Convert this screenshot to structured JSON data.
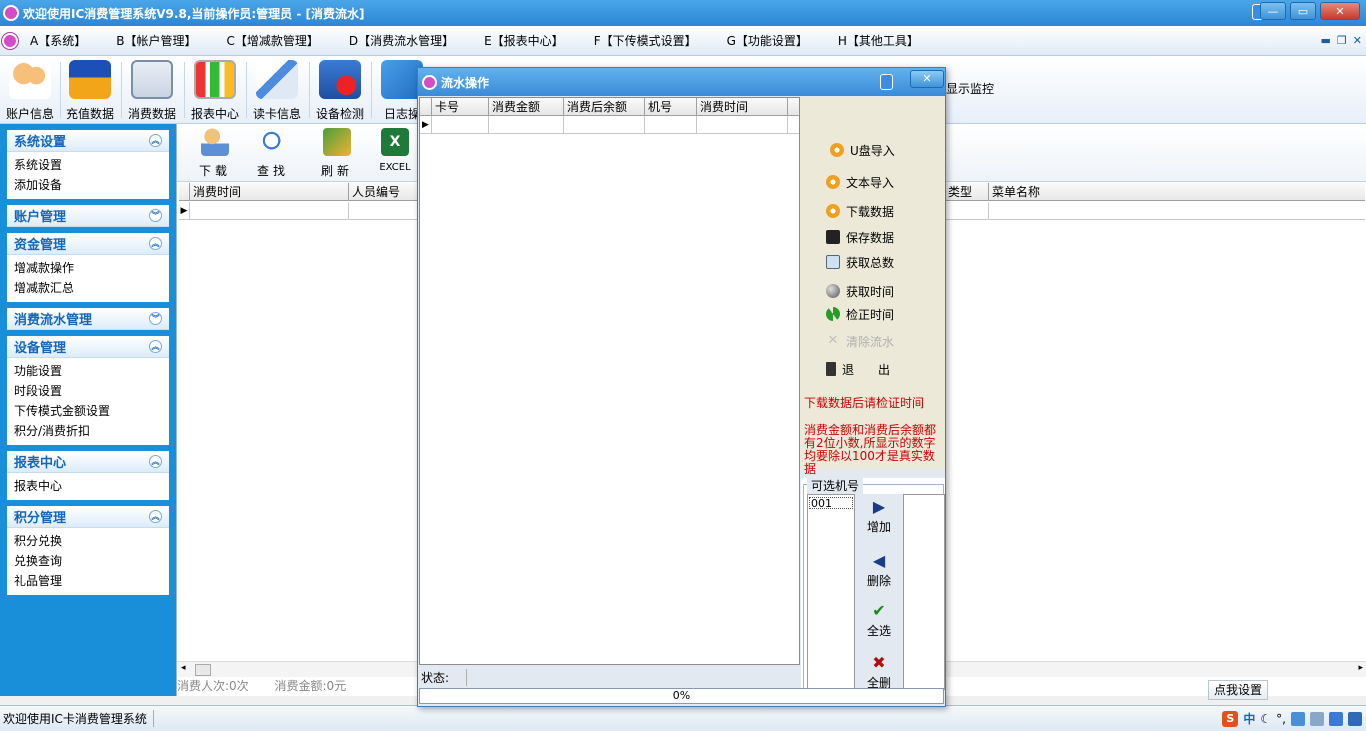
{
  "window": {
    "title": "欢迎使用IC消费管理系统V9.8,当前操作员:管理员 - [消费流水]"
  },
  "menu": [
    "A【系统】",
    "B【帐户管理】",
    "C【增减款管理】",
    "D【消费流水管理】",
    "E【报表中心】",
    "F【下传模式设置】",
    "G【功能设置】",
    "H【其他工具】"
  ],
  "toolbar": {
    "items": [
      "账户信息",
      "充值数据",
      "消费数据",
      "报表中心",
      "读卡信息",
      "设备检测",
      "日志操"
    ],
    "right_label": "显示监控"
  },
  "sidebar": {
    "groups": [
      {
        "title": "系统设置",
        "items": [
          "系统设置",
          "添加设备"
        ]
      },
      {
        "title": "账户管理",
        "items": []
      },
      {
        "title": "资金管理",
        "items": [
          "增减款操作",
          "增减款汇总"
        ]
      },
      {
        "title": "消费流水管理",
        "items": []
      },
      {
        "title": "设备管理",
        "items": [
          "功能设置",
          "时段设置",
          "下传模式金额设置",
          "积分/消费折扣"
        ]
      },
      {
        "title": "报表中心",
        "items": [
          "报表中心"
        ]
      },
      {
        "title": "积分管理",
        "items": [
          "积分兑换",
          "兑换查询",
          "礼品管理"
        ]
      }
    ]
  },
  "subtoolbar": {
    "items": [
      "下载",
      "查找",
      "刷新",
      "EXCEL"
    ]
  },
  "main_grid": {
    "columns": [
      "消费时间",
      "人员编号"
    ],
    "right_columns": [
      "类型",
      "菜单名称"
    ]
  },
  "footer": {
    "count": "消费人次:0次",
    "amount": "消费金额:0元",
    "settings_button": "点我设置"
  },
  "statusbar": {
    "text": "欢迎使用IC卡消费管理系统",
    "ime_lang": "中"
  },
  "dialog": {
    "title": "流水操作",
    "columns": [
      "卡号",
      "消费金额",
      "消费后余额",
      "机号",
      "消费时间"
    ],
    "actions": [
      "U盘导入",
      "文本导入",
      "下载数据",
      "保存数据",
      "获取总数",
      "获取时间",
      "检正时间",
      "清除流水",
      "退　　出"
    ],
    "warning1": "下载数据后请检证时间",
    "warning2": "消费金额和消费后余额都有2位小数,所显示的数字均要除以100才是真实数据",
    "machine_group": "可选机号",
    "machine_options": [
      "001"
    ],
    "machine_buttons": [
      "增加",
      "删除",
      "全选",
      "全删"
    ],
    "status_label": "状态:",
    "progress": "0%"
  }
}
